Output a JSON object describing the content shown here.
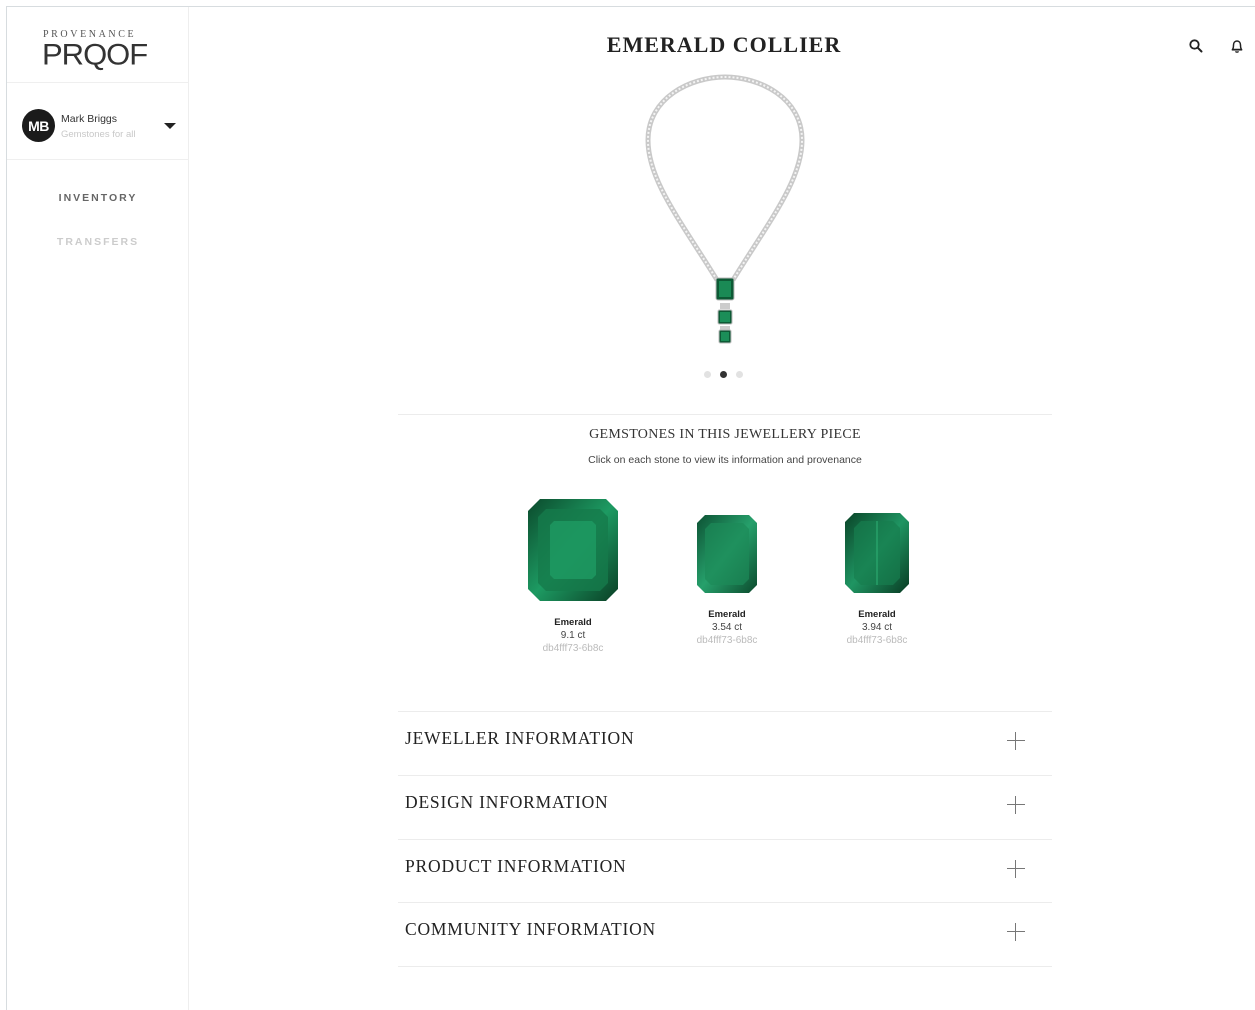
{
  "brand": {
    "tagline": "PROVENANCE",
    "name": "PRQOF"
  },
  "user": {
    "initials": "MB",
    "name": "Mark Briggs",
    "subtitle": "Gemstones for all"
  },
  "nav": {
    "items": [
      {
        "label": "INVENTORY"
      },
      {
        "label": "TRANSFERS"
      }
    ]
  },
  "header": {
    "title": "EMERALD COLLIER"
  },
  "icons": [
    "search-icon",
    "bell-icon",
    "chevron-down-icon",
    "plus-icon"
  ],
  "carousel": {
    "count": 3,
    "active": 1
  },
  "gemstones": {
    "title": "GEMSTONES IN THIS JEWELLERY PIECE",
    "subtitle": "Click on each stone to view its information and provenance",
    "items": [
      {
        "name": "Emerald",
        "carat": "9.1 ct",
        "id": "db4fff73-6b8c"
      },
      {
        "name": "Emerald",
        "carat": "3.54 ct",
        "id": "db4fff73-6b8c"
      },
      {
        "name": "Emerald",
        "carat": "3.94 ct",
        "id": "db4fff73-6b8c"
      }
    ]
  },
  "sections": [
    {
      "label": "JEWELLER INFORMATION"
    },
    {
      "label": "DESIGN INFORMATION"
    },
    {
      "label": "PRODUCT INFORMATION"
    },
    {
      "label": "COMMUNITY INFORMATION"
    }
  ],
  "colors": {
    "emerald_dark": "#0b4a2c",
    "emerald_mid": "#17845a",
    "emerald_light": "#3cc28a",
    "accent": "#222222"
  }
}
